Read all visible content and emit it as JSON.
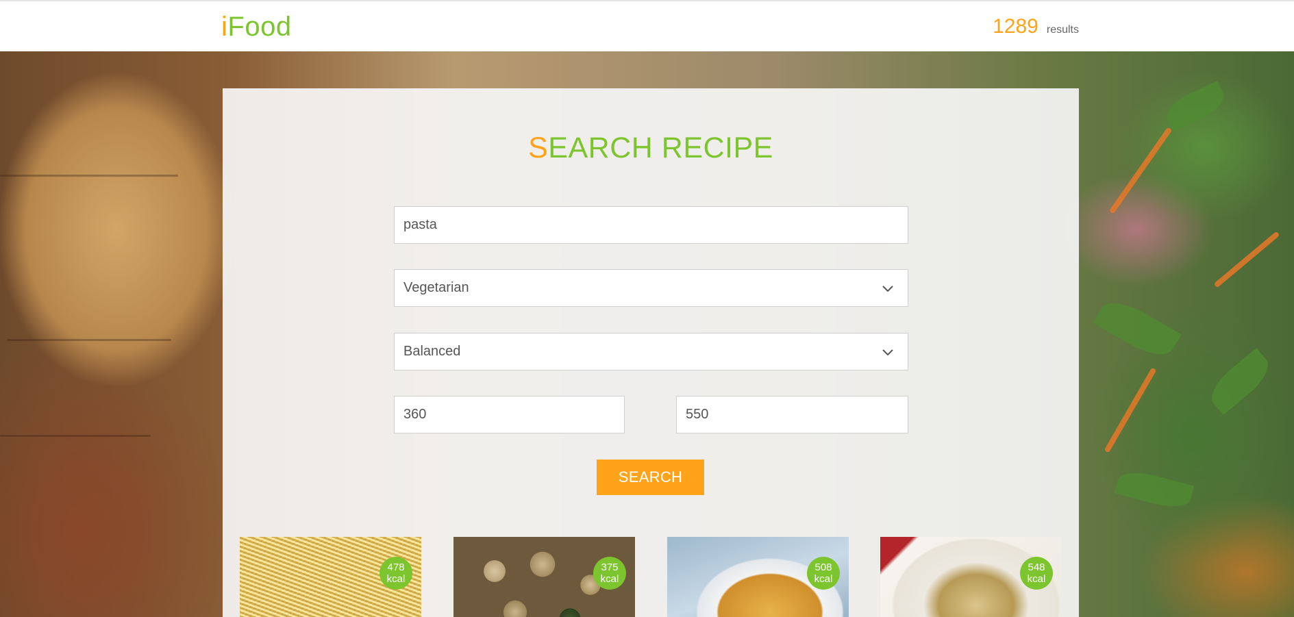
{
  "header": {
    "logo_first": "i",
    "logo_rest": "Food",
    "results_count": "1289",
    "results_label": "results"
  },
  "search": {
    "title_first": "S",
    "title_rest": "EARCH RECIPE",
    "query_value": "pasta",
    "diet_selected": "Vegetarian",
    "health_selected": "Balanced",
    "calories_min": "360",
    "calories_max": "550",
    "search_label": "SEARCH"
  },
  "recipes": [
    {
      "kcal_value": "478",
      "kcal_unit": "kcal",
      "image": "spaghetti"
    },
    {
      "kcal_value": "375",
      "kcal_unit": "kcal",
      "image": "pasta-shells"
    },
    {
      "kcal_value": "508",
      "kcal_unit": "kcal",
      "image": "rice-bowl"
    },
    {
      "kcal_value": "548",
      "kcal_unit": "kcal",
      "image": "penne"
    }
  ],
  "colors": {
    "brand_orange": "#ffa31a",
    "brand_green": "#7dc52e"
  }
}
